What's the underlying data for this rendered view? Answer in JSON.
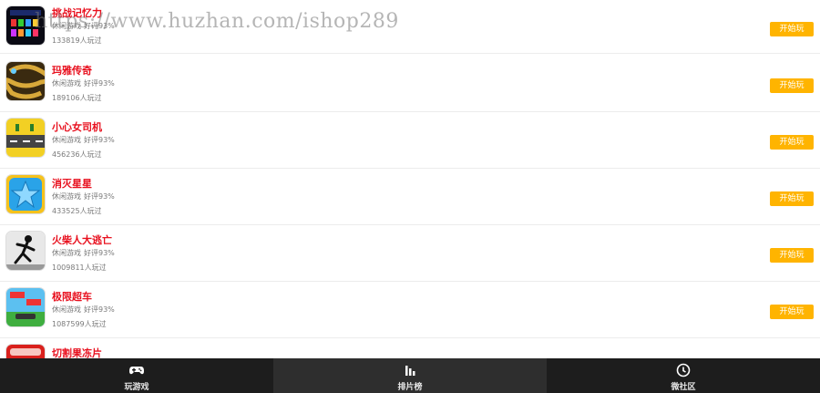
{
  "watermark": "https://www.huzhan.com/ishop289",
  "games": [
    {
      "title": "挑战记忆力",
      "category": "休闲游戏",
      "rating": "好评93%",
      "plays": "133819人玩过",
      "button": "开始玩",
      "icon": "memory-game-icon"
    },
    {
      "title": "玛雅传奇",
      "category": "休闲游戏",
      "rating": "好评93%",
      "plays": "189106人玩过",
      "button": "开始玩",
      "icon": "maya-snake-icon"
    },
    {
      "title": "小心女司机",
      "category": "休闲游戏",
      "rating": "好评93%",
      "plays": "456236人玩过",
      "button": "开始玩",
      "icon": "woman-driver-icon"
    },
    {
      "title": "消灭星星",
      "category": "休闲游戏",
      "rating": "好评93%",
      "plays": "433525人玩过",
      "button": "开始玩",
      "icon": "star-icon"
    },
    {
      "title": "火柴人大逃亡",
      "category": "休闲游戏",
      "rating": "好评93%",
      "plays": "1009811人玩过",
      "button": "开始玩",
      "icon": "stickman-icon"
    },
    {
      "title": "极限超车",
      "category": "休闲游戏",
      "rating": "好评93%",
      "plays": "1087599人玩过",
      "button": "开始玩",
      "icon": "racing-car-icon"
    },
    {
      "title": "切割果冻片",
      "category": "",
      "rating": "",
      "plays": "",
      "button": "",
      "icon": "jelly-icon"
    }
  ],
  "tabbar": [
    {
      "label": "玩游戏",
      "icon": "gamepad-icon",
      "active": false
    },
    {
      "label": "排片榜",
      "icon": "bar-chart-icon",
      "active": true
    },
    {
      "label": "微社区",
      "icon": "clock-icon",
      "active": false
    }
  ],
  "colors": {
    "title": "#e8101e",
    "button": "#ffb400",
    "tabbar": "#1d1d1d"
  }
}
